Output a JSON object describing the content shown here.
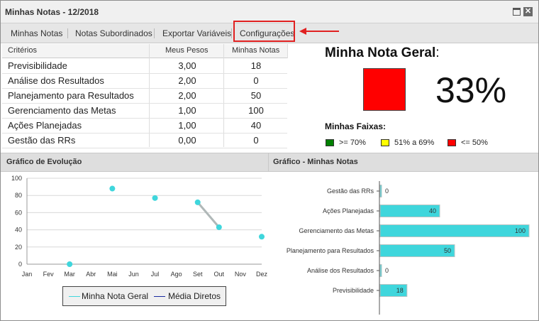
{
  "window": {
    "title": "Minhas Notas - 12/2018"
  },
  "toolbar": {
    "items": [
      "Minhas Notas",
      "Notas Subordinados",
      "Exportar Variáveis",
      "Configurações"
    ]
  },
  "table": {
    "headers": [
      "Critérios",
      "Meus Pesos",
      "Minhas Notas"
    ],
    "rows": [
      {
        "criterio": "Previsibilidade",
        "peso": "3,00",
        "nota": "18"
      },
      {
        "criterio": "Análise dos Resultados",
        "peso": "2,00",
        "nota": "0"
      },
      {
        "criterio": "Planejamento para Resultados",
        "peso": "2,00",
        "nota": "50"
      },
      {
        "criterio": "Gerenciamento das Metas",
        "peso": "1,00",
        "nota": "100"
      },
      {
        "criterio": "Ações Planejadas",
        "peso": "1,00",
        "nota": "40"
      },
      {
        "criterio": "Gestão das RRs",
        "peso": "0,00",
        "nota": "0"
      }
    ]
  },
  "nota_geral": {
    "title": "Minha Nota Geral",
    "colon": ":",
    "value": "33%",
    "status_color": "#ff0000"
  },
  "faixas": {
    "title": "Minhas Faixas:",
    "items": [
      {
        "label": ">= 70%",
        "color": "#008000"
      },
      {
        "label": "51% a 69%",
        "color": "#ffff00"
      },
      {
        "label": "<= 50%",
        "color": "#ff0000"
      }
    ]
  },
  "sections": {
    "evolucao_title": "Gráfico de Evolução",
    "notas_title": "Gráfico - Minhas Notas"
  },
  "chart_data": [
    {
      "type": "line",
      "title": "Gráfico de Evolução",
      "x": [
        "Jan",
        "Fev",
        "Mar",
        "Abr",
        "Mai",
        "Jun",
        "Jul",
        "Ago",
        "Set",
        "Out",
        "Nov",
        "Dez"
      ],
      "ylim": [
        0,
        100
      ],
      "yticks": [
        0,
        20,
        40,
        60,
        80,
        100
      ],
      "grid": true,
      "legend_placement": "bottom",
      "series": [
        {
          "name": "Minha Nota Geral",
          "color": "#3fd6dc",
          "points": [
            [
              "Mar",
              0
            ],
            [
              "Mai",
              88
            ],
            [
              "Jul",
              77
            ],
            [
              "Set",
              72
            ],
            [
              "Out",
              43
            ],
            [
              "Dez",
              32
            ]
          ]
        },
        {
          "name": "Média Diretos",
          "color": "#1a2aa0",
          "points": []
        }
      ]
    },
    {
      "type": "bar",
      "orientation": "horizontal",
      "title": "Gráfico - Minhas Notas",
      "categories": [
        "Gestão das RRs",
        "Ações Planejadas",
        "Gerenciamento das Metas",
        "Planejamento para Resultados",
        "Análise dos Resultados",
        "Previsibilidade"
      ],
      "values": [
        0,
        40,
        100,
        50,
        0,
        18
      ],
      "xlim": [
        0,
        100
      ],
      "color": "#3fd6dc"
    }
  ]
}
